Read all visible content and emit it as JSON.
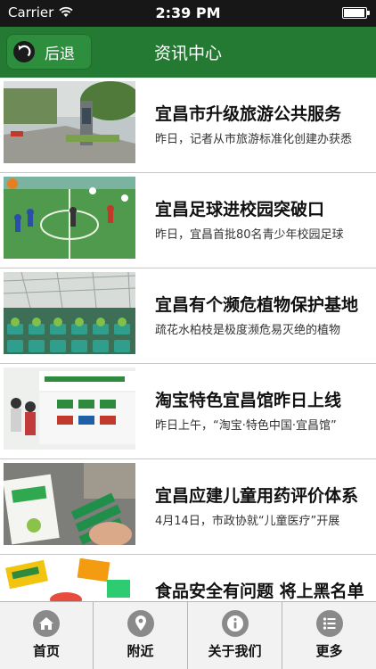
{
  "status_bar": {
    "carrier": "Carrier",
    "time": "2:39 PM"
  },
  "nav": {
    "back_label": "后退",
    "title": "资讯中心"
  },
  "news": [
    {
      "title": "宜昌市升级旅游公共服务",
      "summary": "昨日，记者从市旅游标准化创建办获悉"
    },
    {
      "title": "宜昌足球进校园突破口",
      "summary": "昨日，宜昌首批80名青少年校园足球"
    },
    {
      "title": "宜昌有个濒危植物保护基地",
      "summary": "疏花水柏枝是极度濒危易灭绝的植物"
    },
    {
      "title": "淘宝特色宜昌馆昨日上线",
      "summary": "昨日上午，“淘宝·特色中国·宜昌馆”"
    },
    {
      "title": "宜昌应建儿童用药评价体系",
      "summary": "4月14日，市政协就“儿童医疗”开展"
    },
    {
      "title": "食品安全有问题 将上黑名单",
      "summary": ""
    }
  ],
  "tabs": [
    {
      "label": "首页",
      "icon": "home-icon"
    },
    {
      "label": "附近",
      "icon": "location-pin-icon"
    },
    {
      "label": "关于我们",
      "icon": "info-icon"
    },
    {
      "label": "更多",
      "icon": "list-icon"
    }
  ],
  "colors": {
    "nav_green": "#247a32",
    "status_bar": "#171717",
    "tab_icon_gray": "#8a8a8a"
  }
}
